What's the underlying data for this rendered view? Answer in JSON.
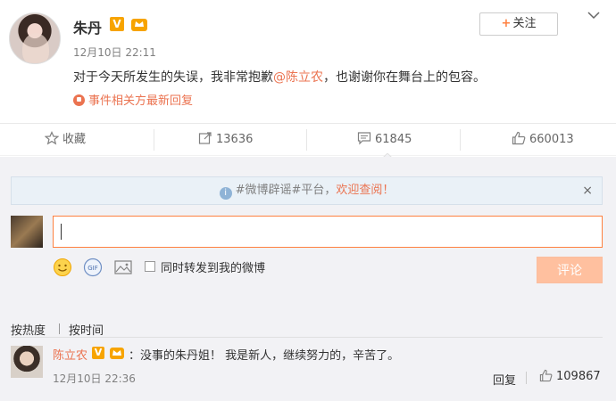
{
  "post": {
    "username": "朱丹",
    "verified_badge": "V",
    "timestamp": "12月10日 22:11",
    "text_before": "对于今天所发生的失误，我非常抱歉",
    "mention": "@陈立农",
    "text_after": "，也谢谢你在舞台上的包容。",
    "related_link": "事件相关方最新回复",
    "follow_label": "关注",
    "follow_plus": "+"
  },
  "actions": {
    "favorite_label": "收藏",
    "repost_count": "13636",
    "comment_count": "61845",
    "like_count": "660013"
  },
  "notice": {
    "text_gray": "#微博辟谣#平台，",
    "text_hot": "欢迎查阅！",
    "info_glyph": "i",
    "close_glyph": "×"
  },
  "composer": {
    "input_value": "",
    "repost_label": "同时转发到我的微博",
    "submit_label": "评论"
  },
  "sort": {
    "by_hot": "按热度",
    "by_time": "按时间"
  },
  "comments": [
    {
      "username": "陈立农",
      "verified_badge": "V",
      "text": "：没事的朱丹姐！ 我是新人，继续努力的，辛苦了。",
      "timestamp": "12月10日 22:36",
      "reply_label": "回复",
      "like_count": "109867"
    }
  ],
  "colors": {
    "accent": "#eb7350",
    "submit_disabled": "#ffc09f",
    "badge": "#f7a400",
    "notice_bg": "#eaf1f7"
  },
  "icons": [
    "star-icon",
    "repost-icon",
    "comment-icon",
    "thumbs-up-icon",
    "chevron-down-icon",
    "emoji-icon",
    "gif-icon",
    "image-icon",
    "info-icon",
    "close-icon"
  ]
}
